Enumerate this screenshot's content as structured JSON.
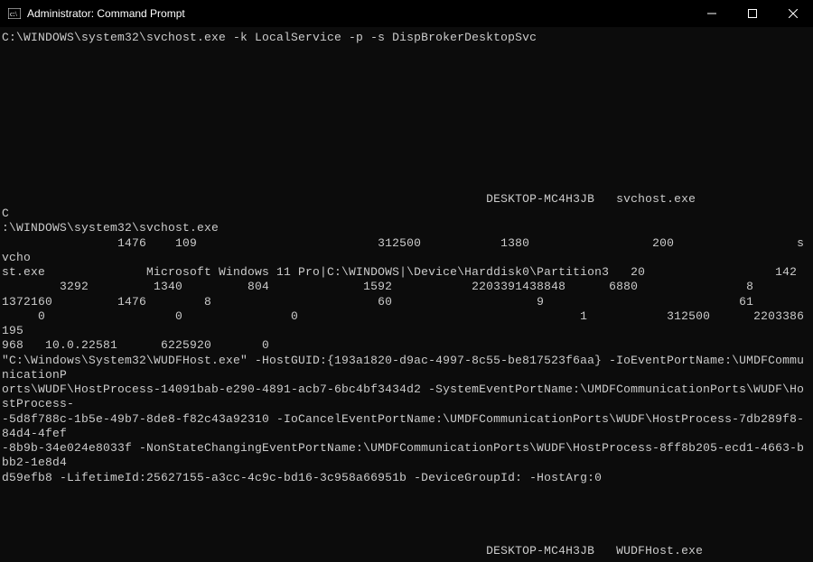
{
  "titlebar": {
    "title": "Administrator: Command Prompt"
  },
  "terminal": {
    "lines": [
      "C:\\WINDOWS\\system32\\svchost.exe -k LocalService -p -s DispBrokerDesktopSvc",
      "",
      "",
      "",
      "",
      "",
      "",
      "",
      "",
      "",
      "",
      "                                                                   DESKTOP-MC4H3JB   svchost.exe                   C",
      ":\\WINDOWS\\system32\\svchost.exe",
      "                1476    109                         312500           1380                 200                 svcho",
      "st.exe              Microsoft Windows 11 Pro|C:\\WINDOWS|\\Device\\Harddisk0\\Partition3   20                  142",
      "        3292         1340         804             1592           2203391438848      6880               8",
      "1372160         1476        8                       60                    9                           61",
      "     0                  0               0                                       1           312500      2203386195",
      "968   10.0.22581      6225920       0",
      "\"C:\\Windows\\System32\\WUDFHost.exe\" -HostGUID:{193a1820-d9ac-4997-8c55-be817523f6aa} -IoEventPortName:\\UMDFCommunicationP",
      "orts\\WUDF\\HostProcess-14091bab-e290-4891-acb7-6bc4bf3434d2 -SystemEventPortName:\\UMDFCommunicationPorts\\WUDF\\HostProcess-",
      "-5d8f788c-1b5e-49b7-8de8-f82c43a92310 -IoCancelEventPortName:\\UMDFCommunicationPorts\\WUDF\\HostProcess-7db289f8-84d4-4fef",
      "-8b9b-34e024e8033f -NonStateChangingEventPortName:\\UMDFCommunicationPorts\\WUDF\\HostProcess-8ff8b205-ecd1-4663-bbb2-1e8d4",
      "d59efb8 -LifetimeId:25627155-a3cc-4c9c-bd16-3c958a66951b -DeviceGroupId: -HostArg:0",
      "",
      "",
      "",
      "",
      "                                                                   DESKTOP-MC4H3JB   WUDFHost.exe"
    ]
  }
}
